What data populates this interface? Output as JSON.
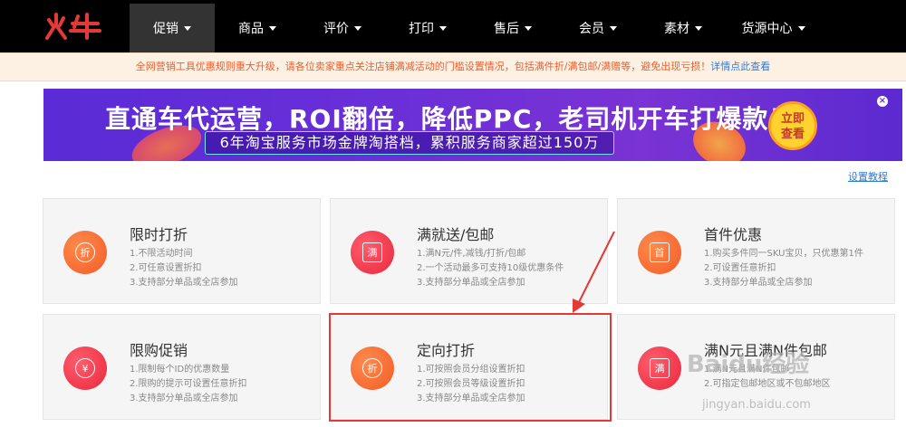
{
  "header": {
    "logo_text": "火牛",
    "nav": [
      {
        "label": "促销",
        "active": true
      },
      {
        "label": "商品"
      },
      {
        "label": "评价"
      },
      {
        "label": "打印"
      },
      {
        "label": "售后"
      },
      {
        "label": "会员"
      },
      {
        "label": "素材"
      },
      {
        "label": "货源中心"
      }
    ]
  },
  "notice": {
    "text": "全网营销工具优惠规则重大升级，请各位卖家重点关注店铺满减活动的门槛设置情况，包括满件折/满包邮/满赠等，避免出现亏损！",
    "link": "详情点此查看"
  },
  "banner": {
    "title": "直通车代运营，ROI翻倍，降低PPC，老司机开车打爆款！",
    "subtitle": "6年淘宝服务市场金牌淘搭档，累积服务商家超过150万",
    "cta_line1": "立即",
    "cta_line2": "查看",
    "close": "×"
  },
  "guide_link": "设置教程",
  "cards": [
    {
      "title": "限时打折",
      "icon_char": "折",
      "color": "orange",
      "lines": [
        "1.不限活动时间",
        "2.可任意设置折扣",
        "3.支持部分单品或全店参加"
      ]
    },
    {
      "title": "满就送/包邮",
      "icon_char": "满",
      "color": "red",
      "lines": [
        "1.满N元/件,减钱/打折/包邮",
        "2.一个活动最多可支持10级优惠条件",
        "3.支持部分单品或全店参加"
      ]
    },
    {
      "title": "首件优惠",
      "icon_char": "首",
      "color": "orange",
      "lines": [
        "1.购买多件同一SKU宝贝，只优惠第1件",
        "2.可设置任意折扣",
        "3.支持部分单品或全店参加"
      ]
    },
    {
      "title": "限购促销",
      "icon_char": "¥",
      "color": "red",
      "lines": [
        "1.限制每个ID的优惠数量",
        "2.限购的提示可设置任意折扣",
        "3.支持部分单品或全店参加"
      ]
    },
    {
      "title": "定向打折",
      "icon_char": "折",
      "color": "orange",
      "lines": [
        "1.可按照会员分组设置折扣",
        "2.可按照会员等级设置折扣",
        "3.支持部分单品或全店参加"
      ]
    },
    {
      "title": "满N元且满N件包邮",
      "icon_char": "满",
      "color": "red",
      "lines": [
        "1.满N元且满N件包邮",
        "2.可指定包邮地区或不包邮地区",
        ""
      ]
    }
  ],
  "watermark": {
    "main": "Baidu经验",
    "sub": "jingyan.baidu.com"
  }
}
